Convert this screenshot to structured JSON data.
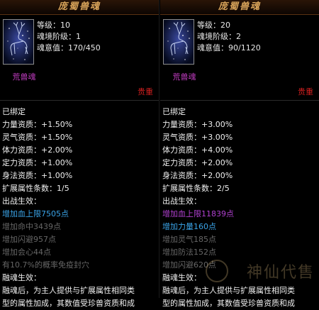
{
  "left": {
    "title": "庞蜀兽魂",
    "stats": [
      {
        "label": "等级：",
        "value": "10"
      },
      {
        "label": "魂境阶级：",
        "value": "1"
      },
      {
        "label": "魂意值：",
        "value": "170/450"
      }
    ],
    "name": "荒兽魂",
    "quality": "贵重",
    "bound": "已绑定",
    "attrs": [
      {
        "label": "力量资质：",
        "value": "+1.50%"
      },
      {
        "label": "灵气资质：",
        "value": "+1.50%"
      },
      {
        "label": "体力资质：",
        "value": "+2.00%"
      },
      {
        "label": "定力资质：",
        "value": "+1.00%"
      },
      {
        "label": "身法资质：",
        "value": "+1.00%"
      },
      {
        "label": "扩展属性条数：",
        "value": "1/5"
      }
    ],
    "effect_title": "出战生效：",
    "effects": [
      {
        "text": "增加血上限7505点",
        "style": "blue"
      },
      {
        "text": "增加命中3439点",
        "style": "grey"
      },
      {
        "text": "增加闪避957点",
        "style": "grey"
      },
      {
        "text": "增加会心44点",
        "style": "grey"
      },
      {
        "text": "有10.7%的概率免疫封穴",
        "style": "grey"
      }
    ],
    "fuse_title": "融魂生效：",
    "fuse_lines": [
      "融魂后，为主人提供与扩展属性相同类",
      "型的属性加成，其数值受珍兽资质和成"
    ]
  },
  "right": {
    "title": "庞蜀兽魂",
    "stats": [
      {
        "label": "等级：",
        "value": "20"
      },
      {
        "label": "魂境阶级：",
        "value": "2"
      },
      {
        "label": "魂意值：",
        "value": "90/1120"
      }
    ],
    "name": "荒兽魂",
    "quality": "贵重",
    "bound": "已绑定",
    "attrs": [
      {
        "label": "力量资质：",
        "value": "+3.00%"
      },
      {
        "label": "灵气资质：",
        "value": "+3.00%"
      },
      {
        "label": "体力资质：",
        "value": "+4.00%"
      },
      {
        "label": "定力资质：",
        "value": "+2.00%"
      },
      {
        "label": "身法资质：",
        "value": "+2.00%"
      },
      {
        "label": "扩展属性条数：",
        "value": "2/5"
      }
    ],
    "effect_title": "出战生效：",
    "effects": [
      {
        "text": "增加血上限11839点",
        "style": "purple"
      },
      {
        "text": "增加力量160点",
        "style": "blue"
      },
      {
        "text": "增加灵气185点",
        "style": "grey"
      },
      {
        "text": "增加防法152点",
        "style": "grey"
      },
      {
        "text": "增加闪避620点",
        "style": "grey"
      }
    ],
    "fuse_title": "融魂生效：",
    "fuse_lines": [
      "融魂后，为主人提供与扩展属性相同类",
      "型的属性加成，其数值受珍兽资质和成"
    ]
  },
  "watermark": "神仙代售"
}
